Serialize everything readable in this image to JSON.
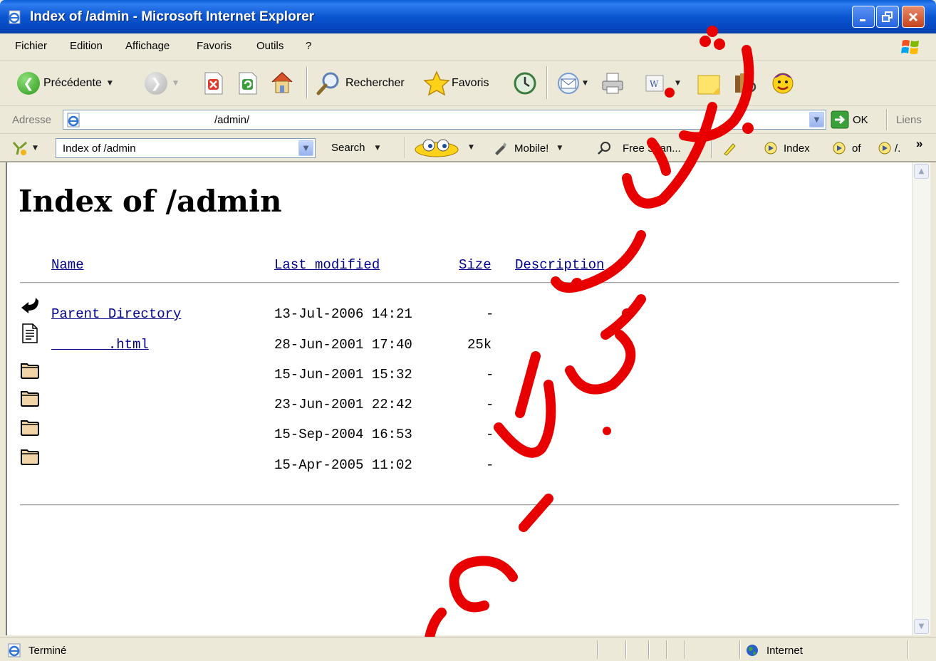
{
  "window": {
    "title": "Index of /admin - Microsoft Internet Explorer"
  },
  "menu": {
    "items": [
      "Fichier",
      "Edition",
      "Affichage",
      "Favoris",
      "Outils",
      "?"
    ]
  },
  "toolbar": {
    "back_label": "Précédente",
    "search_label": "Rechercher",
    "favorites_label": "Favoris"
  },
  "address_bar": {
    "label": "Adresse",
    "value": "/admin/",
    "go_label": "OK",
    "links_label": "Liens"
  },
  "links_toolbar": {
    "search_box_value": "Index of /admin",
    "search_label": "Search",
    "mobile_label": "Mobile!",
    "free_scan_label": "Free Scan...",
    "highlight_1": "Index",
    "highlight_2": "of",
    "highlight_3": "/.",
    "more_chevron": "»"
  },
  "page": {
    "heading": "Index of /admin",
    "columns": {
      "name": "Name",
      "last_modified": "Last modified",
      "size": "Size",
      "description": "Description"
    },
    "rows": [
      {
        "name": "Parent Directory",
        "modified": "13-Jul-2006 14:21",
        "size": "-",
        "icon": "back-arrow-icon"
      },
      {
        "name": "       .html",
        "modified": "28-Jun-2001 17:40",
        "size": "25k",
        "icon": "text-file-icon"
      },
      {
        "name": "",
        "modified": "15-Jun-2001 15:32",
        "size": "-",
        "icon": "folder-icon"
      },
      {
        "name": "",
        "modified": "23-Jun-2001 22:42",
        "size": "-",
        "icon": "folder-icon"
      },
      {
        "name": "",
        "modified": "15-Sep-2004 16:53",
        "size": "-",
        "icon": "folder-icon"
      },
      {
        "name": "",
        "modified": "15-Apr-2005 11:02",
        "size": "-",
        "icon": "folder-icon"
      }
    ]
  },
  "status_bar": {
    "status_text": "Terminé",
    "zone_text": "Internet"
  },
  "colors": {
    "titlebar": "#0b56d0",
    "link": "#00008b",
    "watermark": "#e80000"
  },
  "watermark": {
    "text": "منتديات الأوائل - ....com"
  }
}
